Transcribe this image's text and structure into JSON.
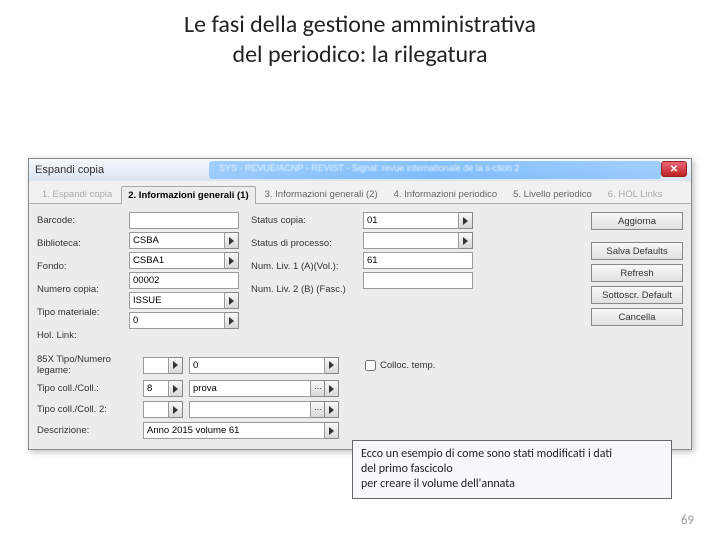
{
  "slide": {
    "title_line1": "Le fasi della gestione amministrativa",
    "title_line2": "del periodico: la rilegatura",
    "page_number": "69"
  },
  "window": {
    "title": "Espandi copia",
    "blurred_sub": "SYS - REVUE/ACNP - REVIST - Signal: revue internationale de la s-ction 2"
  },
  "tabs": [
    {
      "label": "1. Espandi copia",
      "state": "disabled"
    },
    {
      "label": "2. Informazioni generali (1)",
      "state": "active"
    },
    {
      "label": "3. Informazioni generali (2)",
      "state": "normal"
    },
    {
      "label": "4. Informazioni periodico",
      "state": "normal"
    },
    {
      "label": "5. Livello periodico",
      "state": "normal"
    },
    {
      "label": "6. HOL Links",
      "state": "disabled"
    }
  ],
  "left_fields": {
    "barcode_label": "Barcode:",
    "barcode_value": "",
    "biblioteca_label": "Biblioteca:",
    "biblioteca_value": "CSBA",
    "fondo_label": "Fondo:",
    "fondo_value": "CSBA1",
    "numero_copia_label": "Numero copia:",
    "numero_copia_value": "00002",
    "tipo_materiale_label": "Tipo materiale:",
    "tipo_materiale_value": "ISSUE",
    "hol_link_label": "Hol. Link:",
    "hol_link_value": "0"
  },
  "right_fields": {
    "status_copia_label": "Status copia:",
    "status_copia_value": "01",
    "status_processo_label": "Status di processo:",
    "status_processo_value": "",
    "num_liv1_label": "Num. Liv. 1 (A)(Vol.):",
    "num_liv1_value": "61",
    "num_liv2_label": "Num. Liv. 2 (B) (Fasc.)",
    "num_liv2_value": ""
  },
  "wide_rows": {
    "r85x_label": "85X Tipo/Numero legame:",
    "r85x_val1": "",
    "r85x_val2": "0",
    "coll_label": "Tipo coll./Coll.:",
    "coll_val1": "8",
    "coll_val2": "prova",
    "coll2_label": "Tipo coll./Coll. 2:",
    "coll2_val1": "",
    "coll2_val2": "",
    "descr_label": "Descrizione:",
    "descr_value": "Anno 2015 volume 61",
    "colloc_temp_label": "Colloc. temp."
  },
  "buttons": {
    "aggiorna": "Aggiorna",
    "salva_defaults": "Salva Defaults",
    "refresh": "Refresh",
    "sottoscr_default": "Sottoscr. Default",
    "cancella": "Cancella"
  },
  "callout": {
    "line1": "Ecco un esempio di come sono stati modificati i dati",
    "line2": "del primo fascicolo",
    "line3": "per creare il volume dell'annata"
  }
}
